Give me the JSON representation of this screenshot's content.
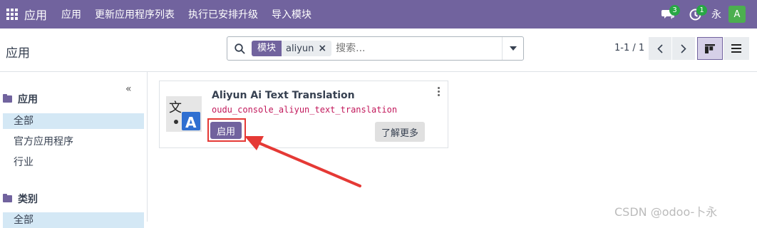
{
  "navbar": {
    "brand": "应用",
    "items": [
      "应用",
      "更新应用程序列表",
      "执行已安排升级",
      "导入模块"
    ],
    "messages_badge": "3",
    "activity_badge": "1",
    "user_name": "永",
    "avatar_letter": "A",
    "bg_color": "#71639e"
  },
  "control_panel": {
    "title": "应用",
    "search": {
      "facet_label": "模块",
      "facet_value": "aliyun",
      "placeholder": "搜索..."
    },
    "pager": {
      "value": "1-1 / 1"
    }
  },
  "sidebar": {
    "collapse_symbol": "«",
    "sections": [
      {
        "title": "应用",
        "items": [
          "全部",
          "官方应用程序",
          "行业"
        ],
        "selected": "全部"
      },
      {
        "title": "类别",
        "items": [
          "全部"
        ],
        "selected": "全部"
      }
    ]
  },
  "card": {
    "title": "Aliyun Ai Text Translation",
    "technical_name": "oudu_console_aliyun_text_translation",
    "activate_label": "启用",
    "learn_more_label": "了解更多",
    "icon_glyph_top": "文",
    "icon_glyph_bottom": "A"
  },
  "watermark": "CSDN @odoo-卜永",
  "colors": {
    "accent": "#71639e",
    "annotation": "#e53935",
    "badge": "#28a745"
  }
}
